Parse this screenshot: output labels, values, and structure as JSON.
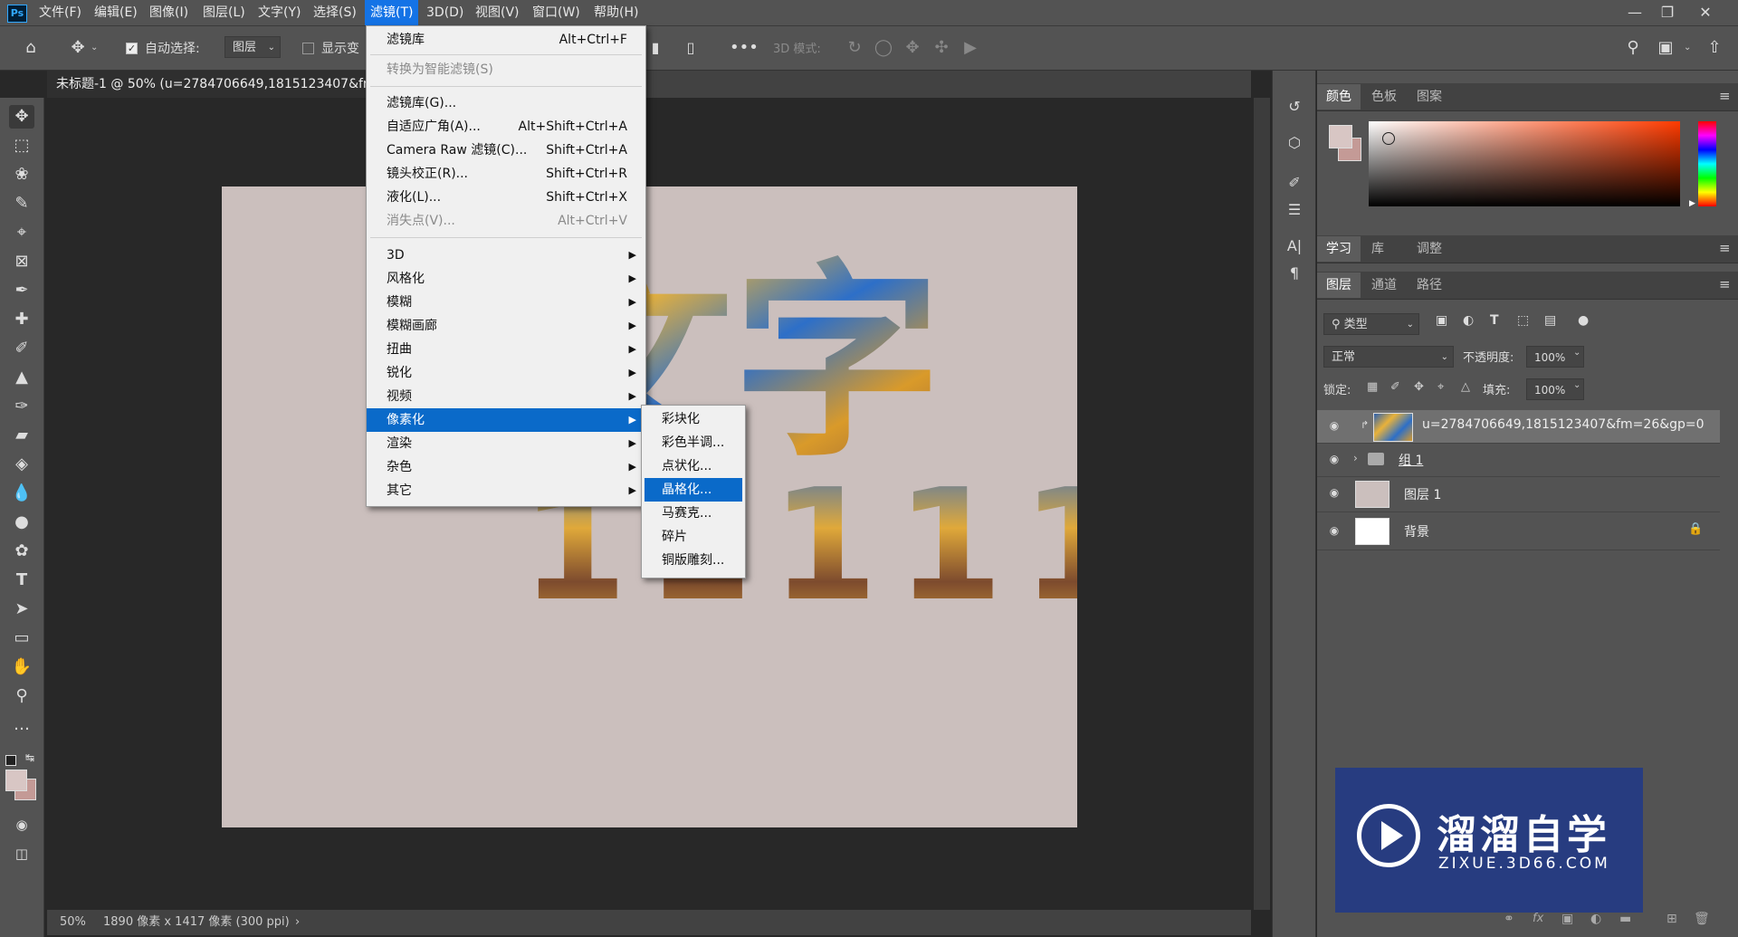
{
  "menubar": {
    "logo": "Ps",
    "items": [
      "文件(F)",
      "编辑(E)",
      "图像(I)",
      "图层(L)",
      "文字(Y)",
      "选择(S)",
      "滤镜(T)",
      "3D(D)",
      "视图(V)",
      "窗口(W)",
      "帮助(H)"
    ]
  },
  "options": {
    "auto_select_label": "自动选择:",
    "auto_select_value": "图层",
    "show_transform_label": "显示变",
    "mode_3d_label": "3D 模式:"
  },
  "document": {
    "tab_title": "未标题-1 @ 50% (u=2784706649,1815123407&fm=",
    "big_text": "文字",
    "number_text": "11111",
    "zoom": "50%",
    "dimensions": "1890 像素 x 1417 像素 (300 ppi)"
  },
  "filter_menu": {
    "items": [
      {
        "label": "滤镜库",
        "shortcut": "Alt+Ctrl+F",
        "disabled": false
      },
      {
        "label": "转换为智能滤镜(S)",
        "shortcut": "",
        "disabled": true
      },
      {
        "label": "滤镜库(G)...",
        "shortcut": "",
        "disabled": false
      },
      {
        "label": "自适应广角(A)...",
        "shortcut": "Alt+Shift+Ctrl+A",
        "disabled": false
      },
      {
        "label": "Camera Raw 滤镜(C)...",
        "shortcut": "Shift+Ctrl+A",
        "disabled": false
      },
      {
        "label": "镜头校正(R)...",
        "shortcut": "Shift+Ctrl+R",
        "disabled": false
      },
      {
        "label": "液化(L)...",
        "shortcut": "Shift+Ctrl+X",
        "disabled": false
      },
      {
        "label": "消失点(V)...",
        "shortcut": "Alt+Ctrl+V",
        "disabled": true
      }
    ],
    "submenus": [
      "3D",
      "风格化",
      "模糊",
      "模糊画廊",
      "扭曲",
      "锐化",
      "视频",
      "像素化",
      "渲染",
      "杂色",
      "其它"
    ],
    "highlighted_submenu": "像素化"
  },
  "pixelate_submenu": {
    "items": [
      "彩块化",
      "彩色半调...",
      "点状化...",
      "晶格化...",
      "马赛克...",
      "碎片",
      "铜版雕刻..."
    ],
    "highlighted": "晶格化..."
  },
  "color_panel": {
    "tabs": [
      "颜色",
      "色板",
      "图案"
    ],
    "foreground": "#d8c6c4",
    "background": "#c49a96"
  },
  "learn_panel": {
    "tabs": [
      "学习",
      "库",
      "调整"
    ]
  },
  "layers_panel": {
    "tabs": [
      "图层",
      "通道",
      "路径"
    ],
    "filter_label": "类型",
    "blend_mode": "正常",
    "opacity_label": "不透明度:",
    "opacity_value": "100%",
    "lock_label": "锁定:",
    "fill_label": "填充:",
    "fill_value": "100%",
    "layers": [
      {
        "name": "u=2784706649,1815123407&fm=26&gp=0",
        "selected": true
      },
      {
        "name": "组 1",
        "selected": false
      },
      {
        "name": "图层 1",
        "selected": false
      },
      {
        "name": "背景",
        "selected": false
      }
    ]
  },
  "watermark": {
    "title": "溜溜自学",
    "subtitle": "ZIXUE.3D66.COM"
  }
}
